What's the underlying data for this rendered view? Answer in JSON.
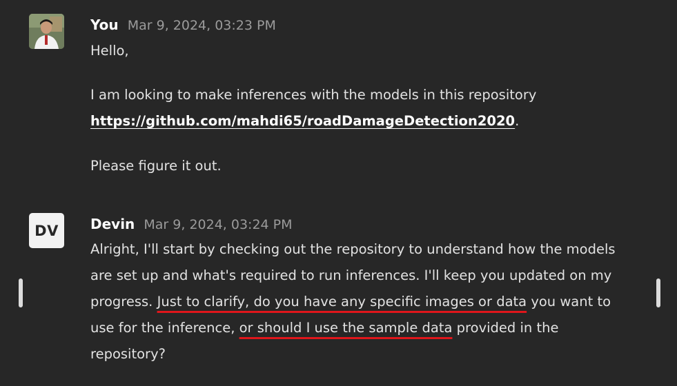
{
  "messages": [
    {
      "author": "You",
      "timestamp": "Mar 9, 2024, 03:23 PM",
      "greeting": "Hello,",
      "line1": "I am looking to make inferences with the models in this repository",
      "link": "https://github.com/mahdi65/roadDamageDetection2020",
      "link_suffix": ".",
      "closing": "Please figure it out."
    },
    {
      "author": "Devin",
      "avatar_initials": "DV",
      "timestamp": "Mar 9, 2024, 03:24 PM",
      "line1": "Alright, I'll start by checking out the repository to understand how the models",
      "line2": "are set up and what's required to run inferences. I'll keep you updated on my",
      "line3_pre": "progress. ",
      "line3_highlight": "Just to clarify, do you have any specific images or data",
      "line3_post": " you want to",
      "line4_pre": "use for the inference, ",
      "line4_highlight": "or should I use the sample data",
      "line4_post": " provided in the",
      "line5": "repository?"
    }
  ],
  "colors": {
    "background": "#272727",
    "text": "#e2e2e2",
    "timestamp": "#9b9b9b",
    "annotation": "#e0161b"
  }
}
